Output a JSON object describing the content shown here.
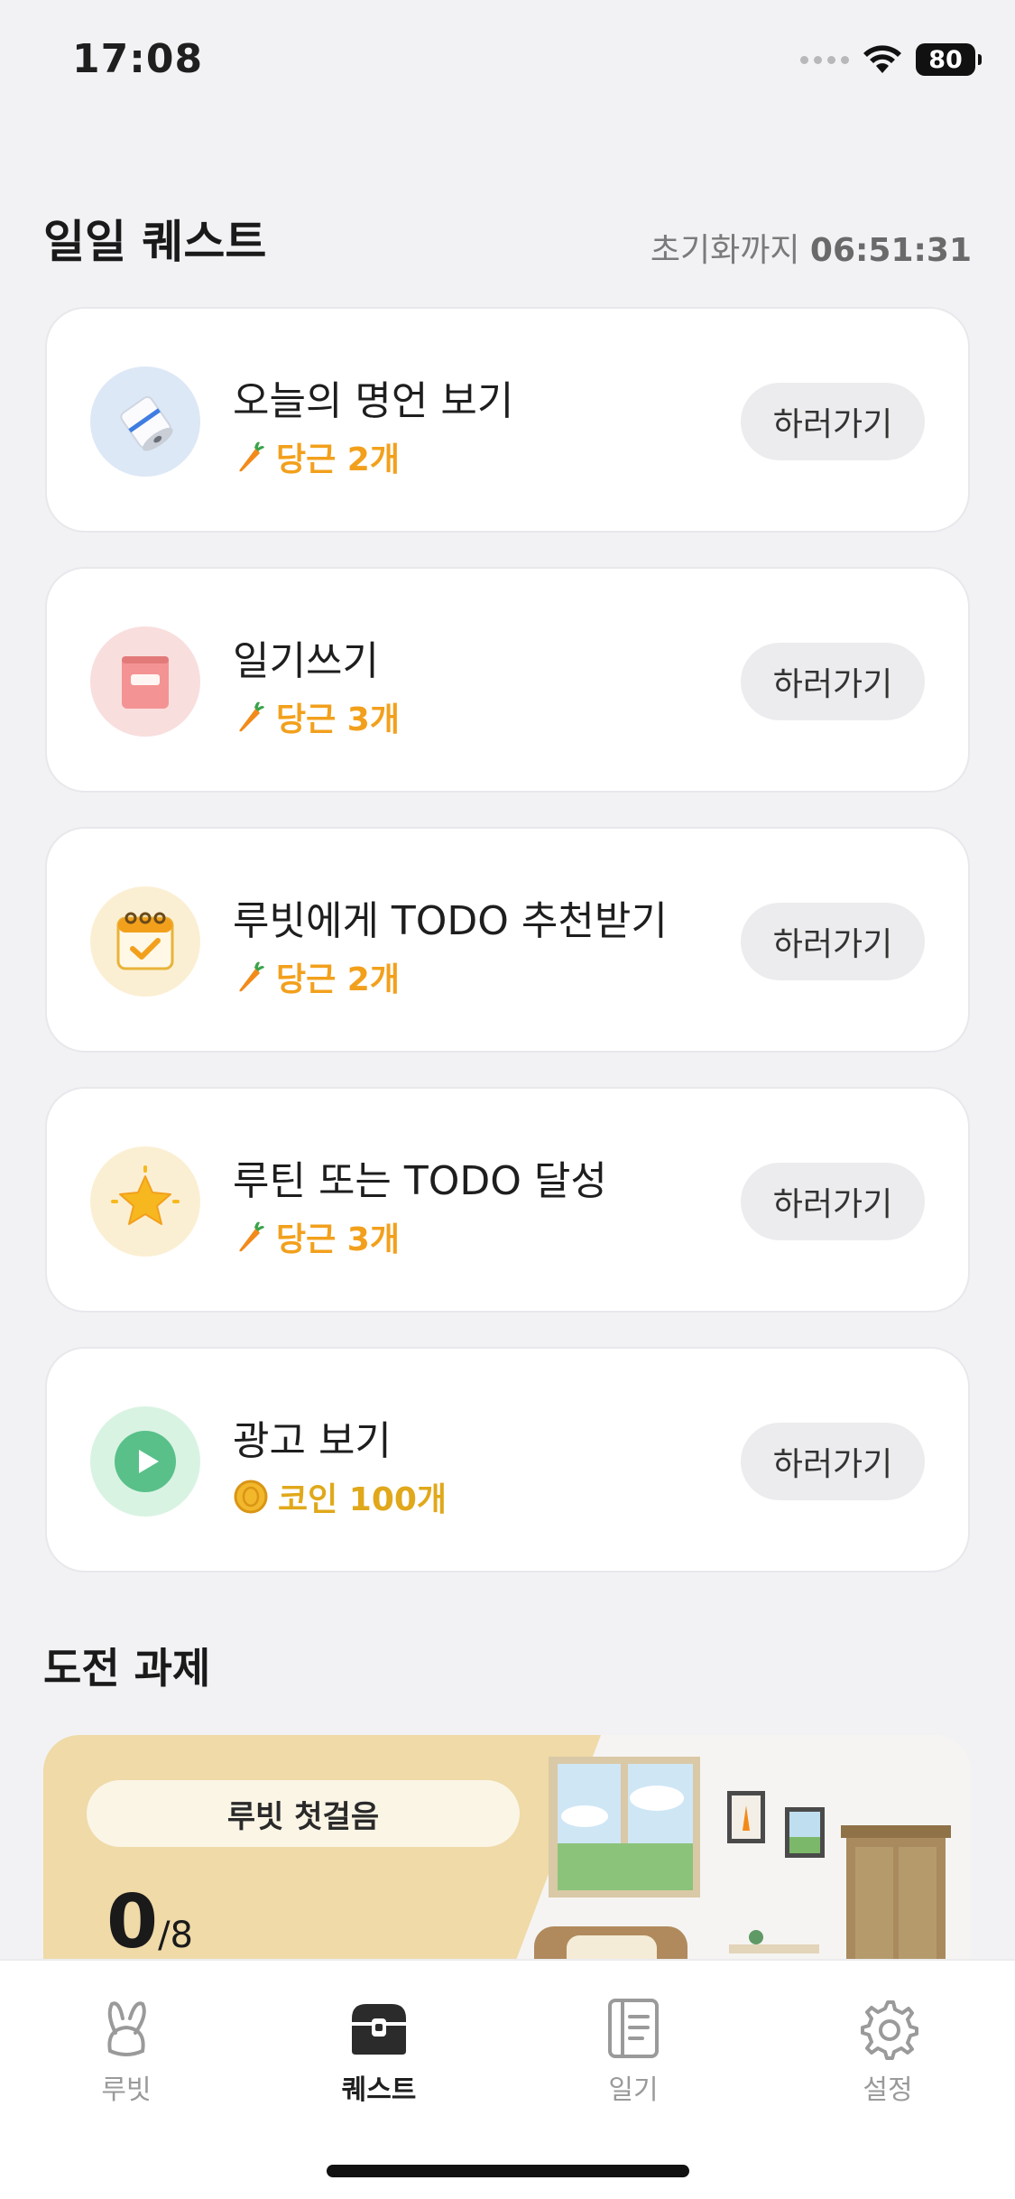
{
  "status_bar": {
    "time": "17:08",
    "battery": "80"
  },
  "daily_quests": {
    "title": "일일 퀘스트",
    "reset_label": "초기화까지",
    "reset_time": "06:51:31",
    "items": [
      {
        "title": "오늘의 명언 보기",
        "reward": "당근 2개",
        "reward_type": "carrot",
        "icon": "scroll-icon",
        "icon_bg": "#dde8f6",
        "button": "하러가기"
      },
      {
        "title": "일기쓰기",
        "reward": "당근 3개",
        "reward_type": "carrot",
        "icon": "diary-book-icon",
        "icon_bg": "#f9dede",
        "button": "하러가기"
      },
      {
        "title": "루빗에게 TODO 추천받기",
        "reward": "당근 2개",
        "reward_type": "carrot",
        "icon": "calendar-check-icon",
        "icon_bg": "#fbefd3",
        "button": "하러가기"
      },
      {
        "title": "루틴 또는 TODO 달성",
        "reward": "당근 3개",
        "reward_type": "carrot",
        "icon": "star-icon",
        "icon_bg": "#fbefd3",
        "button": "하러가기"
      },
      {
        "title": "광고 보기",
        "reward": "코인 100개",
        "reward_type": "coin",
        "icon": "play-icon",
        "icon_bg": "#d9f3e3",
        "button": "하러가기"
      }
    ]
  },
  "challenges": {
    "title": "도전 과제",
    "card": {
      "label": "루빗 첫걸음",
      "progress_current": "0",
      "progress_total": "/8"
    }
  },
  "tab_bar": {
    "tabs": [
      {
        "label": "루빗",
        "icon": "rabbit-icon",
        "active": false
      },
      {
        "label": "퀘스트",
        "icon": "treasure-chest-icon",
        "active": true
      },
      {
        "label": "일기",
        "icon": "notebook-icon",
        "active": false
      },
      {
        "label": "설정",
        "icon": "gear-icon",
        "active": false
      }
    ]
  },
  "colors": {
    "reward_orange": "#f2a01c",
    "background": "#f2f2f5"
  }
}
